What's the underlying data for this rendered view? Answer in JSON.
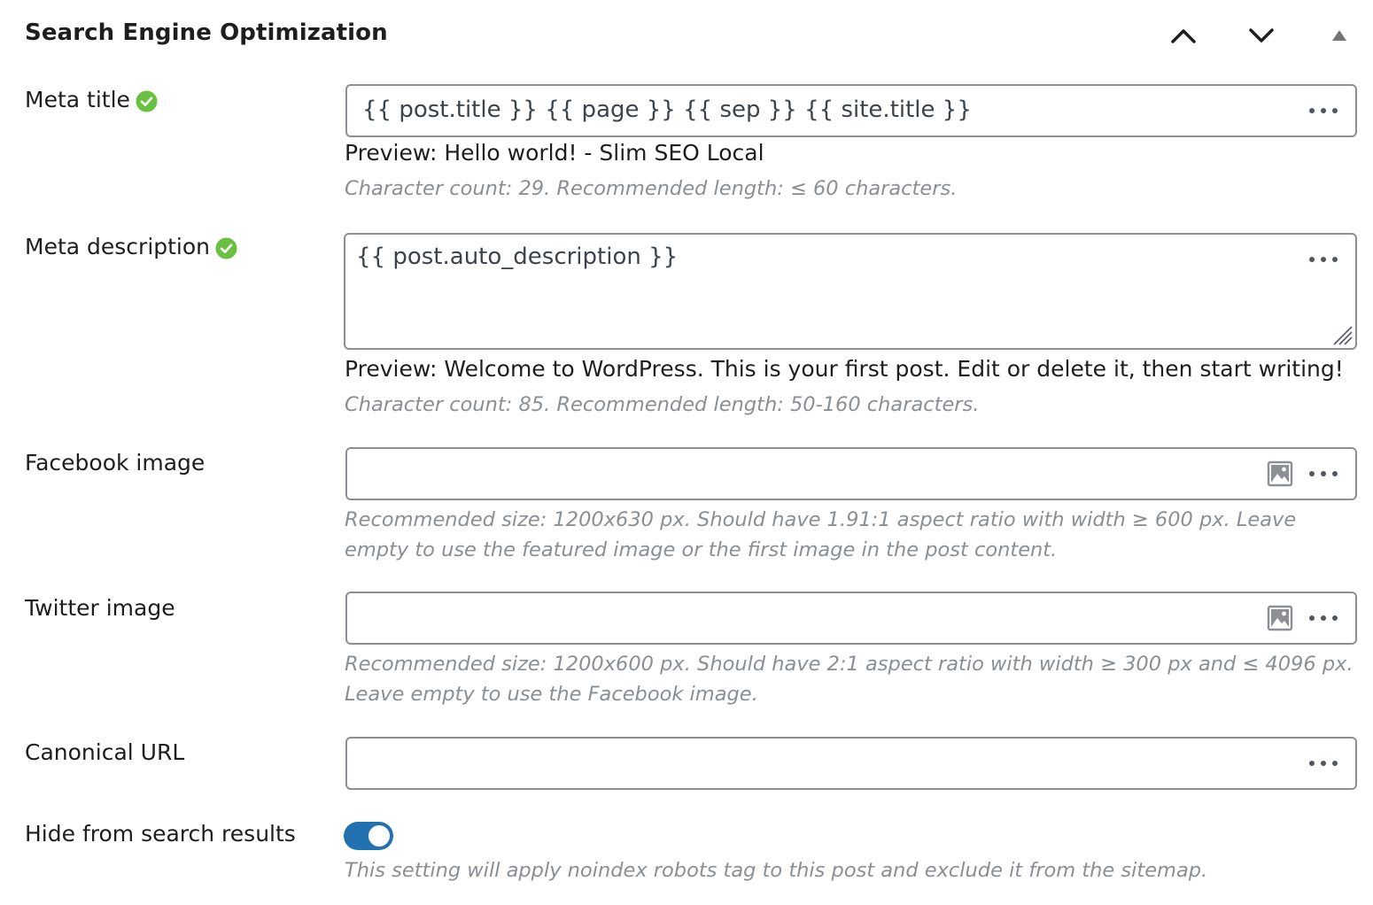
{
  "panel": {
    "title": "Search Engine Optimization",
    "move_up_icon": "chevron-up-icon",
    "move_down_icon": "chevron-down-icon",
    "toggle_icon": "triangle-up-icon"
  },
  "meta_title": {
    "label": "Meta title",
    "status_icon": "green-check-icon",
    "value": "{{ post.title }} {{ page }} {{ sep }} {{ site.title }}",
    "preview": "Preview: Hello world! - Slim SEO Local",
    "hint": "Character count: 29. Recommended length: ≤ 60 characters."
  },
  "meta_description": {
    "label": "Meta description",
    "status_icon": "green-check-icon",
    "value": "{{ post.auto_description }}",
    "preview": "Preview: Welcome to WordPress. This is your first post. Edit or delete it, then start writing!",
    "hint": "Character count: 85. Recommended length: 50-160 characters."
  },
  "facebook_image": {
    "label": "Facebook image",
    "value": "",
    "hint": "Recommended size: 1200x630 px. Should have 1.91:1 aspect ratio with width ≥ 600 px. Leave empty to use the featured image or the first image in the post content."
  },
  "twitter_image": {
    "label": "Twitter image",
    "value": "",
    "hint": "Recommended size: 1200x600 px. Should have 2:1 aspect ratio with width ≥ 300 px and ≤ 4096 px. Leave empty to use the Facebook image."
  },
  "canonical_url": {
    "label": "Canonical URL",
    "value": ""
  },
  "noindex": {
    "label": "Hide from search results",
    "enabled": true,
    "hint": "This setting will apply noindex robots tag to this post and exclude it from the sitemap."
  },
  "colors": {
    "accent": "#2271b1",
    "check_green": "#6ac140",
    "hint_text": "#8a8f94",
    "border": "#8c8f94"
  }
}
